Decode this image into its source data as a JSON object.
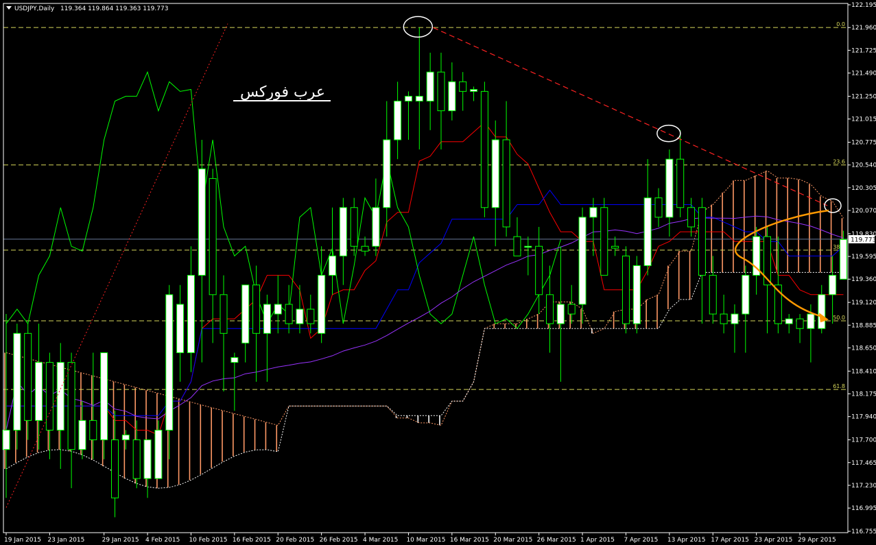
{
  "header": {
    "symbol": "USDJPY,Daily",
    "ohlc": "119.364 119.864 119.363 119.773"
  },
  "watermark": "عرب فوركس",
  "colors": {
    "background": "#000000",
    "grid": "#000000",
    "bull_candle_body": "#ffffff",
    "bear_candle_body": "#000000",
    "candle_wick": "#00ff00",
    "tenkan": "#ff0000",
    "kijun": "#0000ff",
    "chikou": "#00ff00",
    "purple_ma": "#9933ff",
    "kumo_bull": "#ff9966",
    "kumo_bear": "#ffffff",
    "fibo": "#d7d75a",
    "trendline": "#ff2222",
    "arrow": "#ff9900",
    "annotation": "#ffffff"
  },
  "chart_data": {
    "type": "candlestick",
    "title": "",
    "ylim": [
      116.755,
      122.195
    ],
    "y_ticks": [
      "122.195",
      "121.960",
      "121.725",
      "121.490",
      "121.250",
      "121.015",
      "120.775",
      "120.540",
      "120.305",
      "120.070",
      "119.830",
      "119.595",
      "119.360",
      "119.120",
      "118.885",
      "118.650",
      "118.410",
      "118.175",
      "117.940",
      "117.700",
      "117.465",
      "117.230",
      "116.995",
      "116.755"
    ],
    "current_price": "119.773",
    "current_price_value": 119.773,
    "x_labels": [
      "19 Jan 2015",
      "23 Jan 2015",
      "29 Jan 2015",
      "4 Feb 2015",
      "10 Feb 2015",
      "16 Feb 2015",
      "20 Feb 2015",
      "26 Feb 2015",
      "4 Mar 2015",
      "10 Mar 2015",
      "16 Mar 2015",
      "20 Mar 2015",
      "26 Mar 2015",
      "1 Apr 2015",
      "7 Apr 2015",
      "13 Apr 2015",
      "17 Apr 2015",
      "23 Apr 2015",
      "29 Apr 2015"
    ],
    "x_label_bars": [
      0,
      4,
      9,
      13,
      17,
      21,
      25,
      29,
      33,
      37,
      41,
      45,
      49,
      53,
      57,
      61,
      65,
      69,
      73
    ],
    "fibo_levels": [
      {
        "label": "0.0",
        "value": 121.96
      },
      {
        "label": "23.6",
        "value": 120.54
      },
      {
        "label": "38.2",
        "value": 119.66
      },
      {
        "label": "50.0",
        "value": 118.93
      },
      {
        "label": "61.8",
        "value": 118.22
      }
    ],
    "candles": [
      {
        "o": 117.6,
        "h": 119.0,
        "l": 117.1,
        "c": 117.8
      },
      {
        "o": 117.8,
        "h": 118.9,
        "l": 117.6,
        "c": 118.8
      },
      {
        "o": 118.8,
        "h": 118.9,
        "l": 117.7,
        "c": 117.9
      },
      {
        "o": 117.9,
        "h": 118.9,
        "l": 117.6,
        "c": 118.5
      },
      {
        "o": 118.5,
        "h": 118.6,
        "l": 117.5,
        "c": 117.8
      },
      {
        "o": 117.8,
        "h": 118.7,
        "l": 117.4,
        "c": 118.5
      },
      {
        "o": 118.5,
        "h": 118.6,
        "l": 117.2,
        "c": 117.6
      },
      {
        "o": 117.6,
        "h": 118.1,
        "l": 117.5,
        "c": 117.9
      },
      {
        "o": 117.9,
        "h": 118.6,
        "l": 117.5,
        "c": 117.7
      },
      {
        "o": 117.7,
        "h": 118.6,
        "l": 117.5,
        "c": 118.6
      },
      {
        "o": 117.7,
        "h": 118.0,
        "l": 116.9,
        "c": 117.1
      },
      {
        "o": 117.7,
        "h": 117.8,
        "l": 117.6,
        "c": 117.75
      },
      {
        "o": 117.7,
        "h": 117.9,
        "l": 117.2,
        "c": 117.3
      },
      {
        "o": 117.3,
        "h": 117.6,
        "l": 117.1,
        "c": 117.7
      },
      {
        "o": 117.3,
        "h": 117.9,
        "l": 117.3,
        "c": 117.8
      },
      {
        "o": 117.8,
        "h": 119.3,
        "l": 117.5,
        "c": 119.2
      },
      {
        "o": 118.6,
        "h": 119.3,
        "l": 118.3,
        "c": 119.1
      },
      {
        "o": 118.6,
        "h": 119.7,
        "l": 118.4,
        "c": 119.4
      },
      {
        "o": 119.4,
        "h": 120.8,
        "l": 118.5,
        "c": 120.5
      },
      {
        "o": 120.4,
        "h": 120.5,
        "l": 118.7,
        "c": 119.2
      },
      {
        "o": 119.2,
        "h": 119.4,
        "l": 118.2,
        "c": 118.8
      },
      {
        "o": 118.5,
        "h": 118.6,
        "l": 118.0,
        "c": 118.55
      },
      {
        "o": 118.7,
        "h": 119.3,
        "l": 118.5,
        "c": 119.3
      },
      {
        "o": 119.3,
        "h": 119.5,
        "l": 118.3,
        "c": 118.8
      },
      {
        "o": 118.8,
        "h": 119.2,
        "l": 118.3,
        "c": 119.1
      },
      {
        "o": 119.0,
        "h": 119.4,
        "l": 118.8,
        "c": 119.1
      },
      {
        "o": 119.1,
        "h": 119.3,
        "l": 118.8,
        "c": 118.9
      },
      {
        "o": 118.9,
        "h": 119.3,
        "l": 118.8,
        "c": 119.05
      },
      {
        "o": 119.05,
        "h": 119.2,
        "l": 118.8,
        "c": 118.9
      },
      {
        "o": 118.8,
        "h": 119.7,
        "l": 118.7,
        "c": 119.4
      },
      {
        "o": 119.4,
        "h": 120.1,
        "l": 119.2,
        "c": 119.6
      },
      {
        "o": 119.6,
        "h": 120.2,
        "l": 119.3,
        "c": 120.1
      },
      {
        "o": 120.1,
        "h": 120.2,
        "l": 119.6,
        "c": 119.7
      },
      {
        "o": 119.7,
        "h": 119.8,
        "l": 119.6,
        "c": 119.65
      },
      {
        "o": 119.7,
        "h": 120.4,
        "l": 119.6,
        "c": 120.1
      },
      {
        "o": 120.1,
        "h": 121.2,
        "l": 119.8,
        "c": 120.8
      },
      {
        "o": 120.8,
        "h": 121.4,
        "l": 120.6,
        "c": 121.2
      },
      {
        "o": 121.2,
        "h": 121.3,
        "l": 120.8,
        "c": 121.25
      },
      {
        "o": 121.2,
        "h": 121.96,
        "l": 120.7,
        "c": 121.25
      },
      {
        "o": 121.2,
        "h": 121.7,
        "l": 120.9,
        "c": 121.5
      },
      {
        "o": 121.5,
        "h": 121.7,
        "l": 120.7,
        "c": 121.1
      },
      {
        "o": 121.1,
        "h": 121.6,
        "l": 121.0,
        "c": 121.4
      },
      {
        "o": 121.4,
        "h": 121.5,
        "l": 121.1,
        "c": 121.3
      },
      {
        "o": 121.3,
        "h": 121.35,
        "l": 121.2,
        "c": 121.32
      },
      {
        "o": 121.3,
        "h": 121.4,
        "l": 120.0,
        "c": 120.1
      },
      {
        "o": 120.1,
        "h": 121.0,
        "l": 119.7,
        "c": 120.8
      },
      {
        "o": 120.8,
        "h": 121.2,
        "l": 119.8,
        "c": 119.9
      },
      {
        "o": 119.8,
        "h": 120.0,
        "l": 119.6,
        "c": 119.6
      },
      {
        "o": 119.7,
        "h": 119.8,
        "l": 119.4,
        "c": 119.7
      },
      {
        "o": 119.7,
        "h": 119.9,
        "l": 119.0,
        "c": 119.2
      },
      {
        "o": 119.2,
        "h": 119.5,
        "l": 118.6,
        "c": 118.9
      },
      {
        "o": 118.9,
        "h": 119.7,
        "l": 118.3,
        "c": 119.1
      },
      {
        "o": 119.1,
        "h": 119.3,
        "l": 118.9,
        "c": 119.0
      },
      {
        "o": 119.1,
        "h": 120.1,
        "l": 118.9,
        "c": 120.0
      },
      {
        "o": 120.0,
        "h": 120.2,
        "l": 119.6,
        "c": 120.1
      },
      {
        "o": 120.1,
        "h": 120.2,
        "l": 119.4,
        "c": 119.4
      },
      {
        "o": 119.7,
        "h": 119.8,
        "l": 119.6,
        "c": 119.68
      },
      {
        "o": 119.6,
        "h": 119.7,
        "l": 118.8,
        "c": 118.9
      },
      {
        "o": 118.9,
        "h": 119.6,
        "l": 118.8,
        "c": 119.5
      },
      {
        "o": 119.5,
        "h": 120.6,
        "l": 119.4,
        "c": 120.2
      },
      {
        "o": 120.2,
        "h": 120.3,
        "l": 119.9,
        "c": 120.0
      },
      {
        "o": 120.0,
        "h": 120.7,
        "l": 119.8,
        "c": 120.6
      },
      {
        "o": 120.6,
        "h": 120.9,
        "l": 120.0,
        "c": 120.1
      },
      {
        "o": 120.1,
        "h": 120.2,
        "l": 119.8,
        "c": 119.9
      },
      {
        "o": 120.1,
        "h": 120.2,
        "l": 118.9,
        "c": 119.4
      },
      {
        "o": 119.4,
        "h": 119.6,
        "l": 118.9,
        "c": 119.0
      },
      {
        "o": 119.0,
        "h": 119.2,
        "l": 118.8,
        "c": 118.9
      },
      {
        "o": 118.9,
        "h": 119.1,
        "l": 118.6,
        "c": 119.0
      },
      {
        "o": 119.0,
        "h": 119.5,
        "l": 118.6,
        "c": 119.4
      },
      {
        "o": 119.4,
        "h": 119.9,
        "l": 119.2,
        "c": 119.8
      },
      {
        "o": 119.8,
        "h": 119.9,
        "l": 118.8,
        "c": 119.3
      },
      {
        "o": 119.3,
        "h": 119.8,
        "l": 118.8,
        "c": 118.9
      },
      {
        "o": 118.9,
        "h": 119.0,
        "l": 118.8,
        "c": 118.95
      },
      {
        "o": 118.95,
        "h": 119.0,
        "l": 118.7,
        "c": 118.85
      },
      {
        "o": 118.85,
        "h": 119.1,
        "l": 118.5,
        "c": 119.0
      },
      {
        "o": 118.85,
        "h": 119.3,
        "l": 118.8,
        "c": 119.2
      },
      {
        "o": 119.2,
        "h": 119.6,
        "l": 118.9,
        "c": 119.4
      },
      {
        "o": 119.36,
        "h": 119.86,
        "l": 119.36,
        "c": 119.77
      }
    ]
  }
}
